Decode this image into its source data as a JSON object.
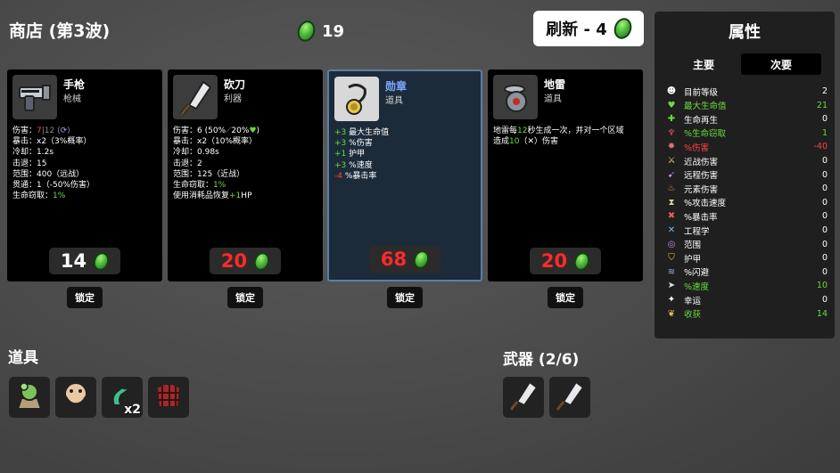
{
  "header": {
    "title": "商店 (第3波)",
    "coins": "19",
    "reroll_label": "刷新 - 4"
  },
  "shop": {
    "cards": [
      {
        "name": "手枪",
        "type": "枪械",
        "price": "14",
        "price_color": "#ffffff",
        "lock_label": "锁定",
        "stats": [
          [
            [
              "伤害：",
              ""
            ],
            [
              "7",
              "r"
            ],
            [
              "|12 (",
              "gy"
            ],
            [
              "⟳",
              "pu"
            ],
            [
              ")",
              "gy"
            ]
          ],
          [
            [
              "暴击：x2（3%概率）",
              ""
            ]
          ],
          [
            [
              "冷却：1.2s",
              ""
            ]
          ],
          [
            [
              "击退：15",
              ""
            ]
          ],
          [
            [
              "范围：400（远战）",
              ""
            ]
          ],
          [
            [
              "贯通：1（-50%伤害）",
              ""
            ]
          ],
          [
            [
              "生命窃取：",
              ""
            ],
            [
              "1%",
              "g"
            ]
          ]
        ]
      },
      {
        "name": "砍刀",
        "type": "利器",
        "price": "20",
        "price_color": "#ff2a2a",
        "lock_label": "锁定",
        "stats": [
          [
            [
              "伤害：6 (50%",
              ""
            ],
            [
              "⟋",
              "gy"
            ],
            [
              "20%",
              ""
            ],
            [
              "♥",
              "g"
            ],
            [
              ")",
              ""
            ]
          ],
          [
            [
              "暴击：x2（10%概率）",
              ""
            ]
          ],
          [
            [
              "冷却：0.98s",
              ""
            ]
          ],
          [
            [
              "击退：2",
              ""
            ]
          ],
          [
            [
              "范围：125（近战）",
              ""
            ]
          ],
          [
            [
              "生命窃取：",
              ""
            ],
            [
              "1%",
              "g"
            ]
          ],
          [
            [
              "使用消耗品恢复",
              ""
            ],
            [
              "+1",
              "g"
            ],
            [
              "HP",
              ""
            ]
          ]
        ]
      },
      {
        "name": "勋章",
        "type": "道具",
        "price": "68",
        "price_color": "#ff2a2a",
        "lock_label": "锁定",
        "stats": [
          [
            [
              "+3",
              "g"
            ],
            [
              " 最大生命值",
              ""
            ]
          ],
          [
            [
              "+3",
              "g"
            ],
            [
              " %伤害",
              ""
            ]
          ],
          [
            [
              "+1",
              "g"
            ],
            [
              " 护甲",
              ""
            ]
          ],
          [
            [
              "+3",
              "g"
            ],
            [
              " %速度",
              ""
            ]
          ],
          [
            [
              "-4",
              "r"
            ],
            [
              " %暴击率",
              ""
            ]
          ]
        ]
      },
      {
        "name": "地雷",
        "type": "道具",
        "price": "20",
        "price_color": "#ff2a2a",
        "lock_label": "锁定",
        "stats": [
          [
            [
              "地雷每",
              ""
            ],
            [
              "12",
              "g"
            ],
            [
              "秒生成一次，并对一个区域",
              ""
            ]
          ],
          [
            [
              "造成",
              ""
            ],
            [
              "10",
              "g"
            ],
            [
              "（✕）伤害",
              ""
            ]
          ]
        ]
      }
    ]
  },
  "items_section": {
    "title": "道具",
    "items": [
      {
        "icon": "cactus-bag-icon",
        "count": ""
      },
      {
        "icon": "bearded-face-icon",
        "count": ""
      },
      {
        "icon": "green-lizard-icon",
        "count": "x2"
      },
      {
        "icon": "plaid-shirt-icon",
        "count": ""
      }
    ]
  },
  "weapons_section": {
    "title": "武器 (2/6)",
    "weapons": [
      {
        "icon": "cleaver-icon"
      },
      {
        "icon": "cleaver-icon"
      }
    ]
  },
  "stats_panel": {
    "title": "属性",
    "tabs": {
      "primary": "主要",
      "secondary": "次要"
    },
    "rows": [
      {
        "icon": "level-icon",
        "label": "目前等级",
        "value": "2",
        "color": "#ffffff"
      },
      {
        "icon": "heart-icon",
        "label": "最大生命值",
        "value": "21",
        "color": "#6bdc3b"
      },
      {
        "icon": "regen-icon",
        "label": "生命再生",
        "value": "0",
        "color": "#ffffff"
      },
      {
        "icon": "lifesteal-icon",
        "label": "%生命窃取",
        "value": "1",
        "color": "#6bdc3b"
      },
      {
        "icon": "damage-icon",
        "label": "%伤害",
        "value": "-40",
        "color": "#ff4040"
      },
      {
        "icon": "melee-icon",
        "label": "近战伤害",
        "value": "0",
        "color": "#ffffff"
      },
      {
        "icon": "ranged-icon",
        "label": "远程伤害",
        "value": "0",
        "color": "#ffffff"
      },
      {
        "icon": "elemental-icon",
        "label": "元素伤害",
        "value": "0",
        "color": "#ffffff"
      },
      {
        "icon": "attack-speed-icon",
        "label": "%攻击速度",
        "value": "0",
        "color": "#ffffff"
      },
      {
        "icon": "crit-icon",
        "label": "%暴击率",
        "value": "0",
        "color": "#ffffff"
      },
      {
        "icon": "engineering-icon",
        "label": "工程学",
        "value": "0",
        "color": "#ffffff"
      },
      {
        "icon": "range-icon",
        "label": "范围",
        "value": "0",
        "color": "#ffffff"
      },
      {
        "icon": "armor-icon",
        "label": "护甲",
        "value": "0",
        "color": "#ffffff"
      },
      {
        "icon": "dodge-icon",
        "label": "%闪避",
        "value": "0",
        "color": "#ffffff"
      },
      {
        "icon": "speed-icon",
        "label": "%速度",
        "value": "10",
        "color": "#6bdc3b"
      },
      {
        "icon": "luck-icon",
        "label": "幸运",
        "value": "0",
        "color": "#ffffff"
      },
      {
        "icon": "harvest-icon",
        "label": "收获",
        "value": "14",
        "color": "#6bdc3b"
      }
    ]
  }
}
